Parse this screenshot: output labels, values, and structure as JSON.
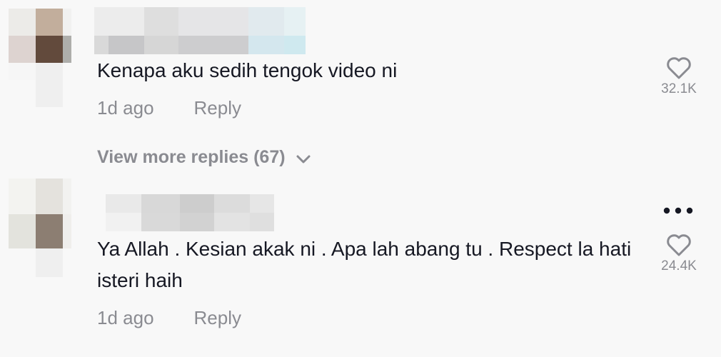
{
  "comments": [
    {
      "text": "Kenapa aku sedih tengok video ni",
      "time": "1d ago",
      "reply_label": "Reply",
      "likes": "32.1K"
    },
    {
      "text": "Ya Allah . Kesian akak ni . Apa lah abang tu . Respect la hati isteri haih",
      "time": "1d ago",
      "reply_label": "Reply",
      "likes": "24.4K"
    }
  ],
  "view_more_label": "View more replies (67)",
  "icons": {
    "like": "heart-icon",
    "more": "more-horizontal-icon",
    "expand": "chevron-down-icon"
  },
  "colors": {
    "background": "#f8f8f8",
    "text": "#161823",
    "muted": "#8a8b91"
  }
}
